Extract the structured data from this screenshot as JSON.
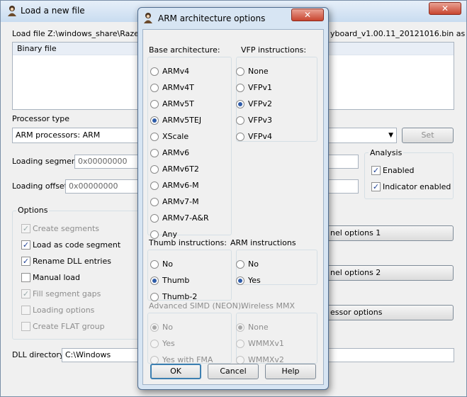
{
  "outer_window": {
    "title": "Load a new file",
    "load_file_label": "Load file Z:\\windows_share\\RazerDe",
    "load_file_suffix": "yboard_v1.00.11_20121016.bin as",
    "list_item": "Binary file",
    "processor_type_label": "Processor type",
    "processor_value": "ARM processors: ARM",
    "set_button": "Set",
    "loading_segment_label": "Loading segment",
    "loading_segment_value": "0x00000000",
    "loading_offset_label": "Loading offset",
    "loading_offset_value": "0x00000000",
    "analysis": {
      "title": "Analysis",
      "enabled": "Enabled",
      "indicator_enabled": "Indicator enabled"
    },
    "options": {
      "title": "Options",
      "create_segments": "Create segments",
      "load_as_code_segment": "Load as code segment",
      "rename_dll_entries": "Rename DLL entries",
      "manual_load": "Manual load",
      "fill_segment_gaps": "Fill segment gaps",
      "loading_options": "Loading options",
      "create_flat_group": "Create FLAT group"
    },
    "kernel_options_1": "nel options 1",
    "kernel_options_2": "nel options 2",
    "processor_options": "essor options",
    "dll_directory_label": "DLL directory",
    "dll_directory_value": "C:\\Windows"
  },
  "dialog": {
    "title": "ARM architecture options",
    "base_arch_title": "Base architecture:",
    "base_arch": [
      "ARMv4",
      "ARMv4T",
      "ARMv5T",
      "ARMv5TEJ",
      "XScale",
      "ARMv6",
      "ARMv6T2",
      "ARMv6-M",
      "ARMv7-M",
      "ARMv7-A&R",
      "Any"
    ],
    "base_arch_selected": "ARMv5TEJ",
    "vfp_title": "VFP instructions:",
    "vfp": [
      "None",
      "VFPv1",
      "VFPv2",
      "VFPv3",
      "VFPv4"
    ],
    "vfp_selected": "VFPv2",
    "thumb_title": "Thumb instructions:",
    "thumb": [
      "No",
      "Thumb",
      "Thumb-2"
    ],
    "thumb_selected": "Thumb",
    "arm_title": "ARM instructions",
    "arm": [
      "No",
      "Yes"
    ],
    "arm_selected": "Yes",
    "simd_title": "Advanced SIMD (NEON):",
    "simd": [
      "No",
      "Yes",
      "Yes with FMA"
    ],
    "simd_selected": "No",
    "mmx_title": "Wireless MMX",
    "mmx": [
      "None",
      "WMMXv1",
      "WMMXv2"
    ],
    "mmx_selected": "None",
    "ok_button": "OK",
    "cancel_button": "Cancel",
    "help_button": "Help"
  }
}
